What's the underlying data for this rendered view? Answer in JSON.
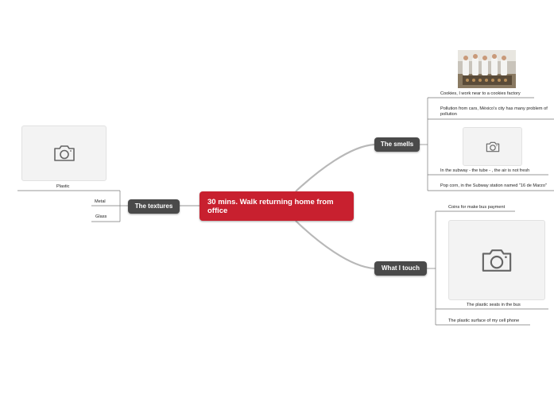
{
  "central": {
    "title": "30 mins. Walk returning home from office"
  },
  "branches": {
    "textures": {
      "label": "The textures",
      "items": [
        "Plastic",
        "Metal",
        "Glass"
      ]
    },
    "smells": {
      "label": "The smells",
      "items": [
        "Cookies, I work near to a cookies factory",
        "Pollution from cars, México's city has many problem of pollution",
        "In the subway - the tube - , the air is not fresh",
        "Pop corn, in the Subway station named \"16 de Marzo\""
      ]
    },
    "touch": {
      "label": "What I touch",
      "items": [
        "Coins for make bus payment",
        "The plastic seats in the bus",
        "The plastic surface of my cell phone"
      ]
    }
  },
  "colors": {
    "central": "#c8202f",
    "main": "#4a4a4a",
    "connector": "#b5b5b5",
    "line": "#555555"
  },
  "icons": {
    "image_placeholder": "camera-icon"
  }
}
